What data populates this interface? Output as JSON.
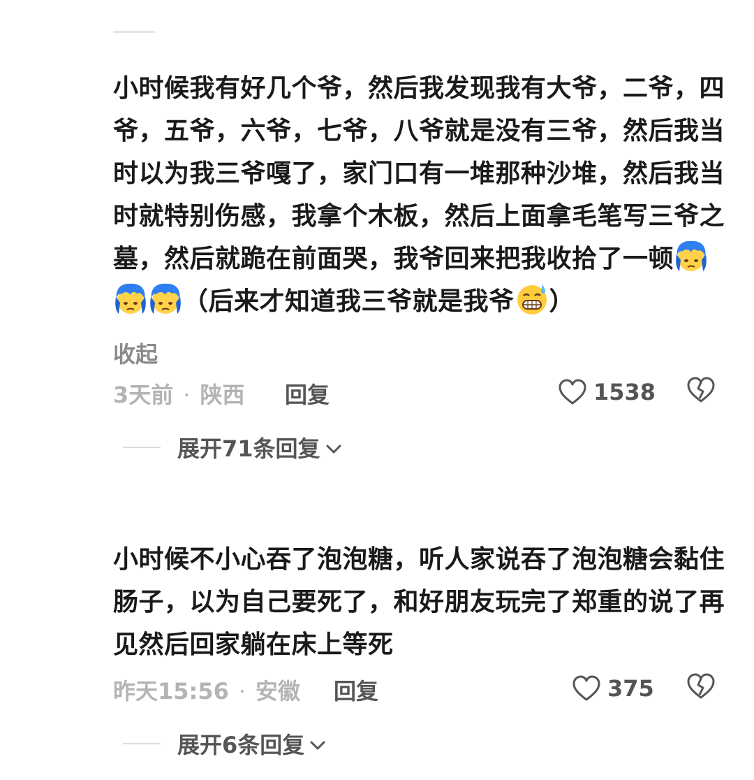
{
  "comments": [
    {
      "text_main": "小时候我有好几个爷，然后我发现我有大爷，二爷，四爷，五爷，六爷，七爷，八爷就是没有三爷，然后我当时以为我三爷嘎了，家门口有一堆那种沙堆，然后我当时就特别伤感，我拿个木板，然后上面拿毛笔写三爷之墓，然后就跪在前面哭，我爷回来把我收拾了一顿",
      "text_tail": "（后来才知道我三爷就是我爷",
      "text_end": "）",
      "emojis": [
        "blue-hair-cry-emoji",
        "blue-hair-cry-emoji",
        "blue-hair-cry-emoji",
        "grin-sweat-emoji"
      ],
      "collapse_label": "收起",
      "time": "3天前",
      "dot": "·",
      "region": "陕西",
      "reply_label": "回复",
      "like_icon": "heart-outline-icon",
      "like_count": "1538",
      "dislike_icon": "broken-heart-icon",
      "expand_label": "展开71条回复"
    },
    {
      "text_main": "小时候不小心吞了泡泡糖，听人家说吞了泡泡糖会黏住肠子，以为自己要死了，和好朋友玩完了郑重的说了再见然后回家躺在床上等死",
      "time": "昨天15:56",
      "dot": "·",
      "region": "安徽",
      "reply_label": "回复",
      "like_icon": "heart-outline-icon",
      "like_count": "375",
      "dislike_icon": "broken-heart-icon",
      "expand_label": "展开6条回复"
    }
  ],
  "colors": {
    "text": "#1a1a1a",
    "muted": "#b4b4b4",
    "secondary": "#555555",
    "collapse": "#8a8a8a"
  }
}
